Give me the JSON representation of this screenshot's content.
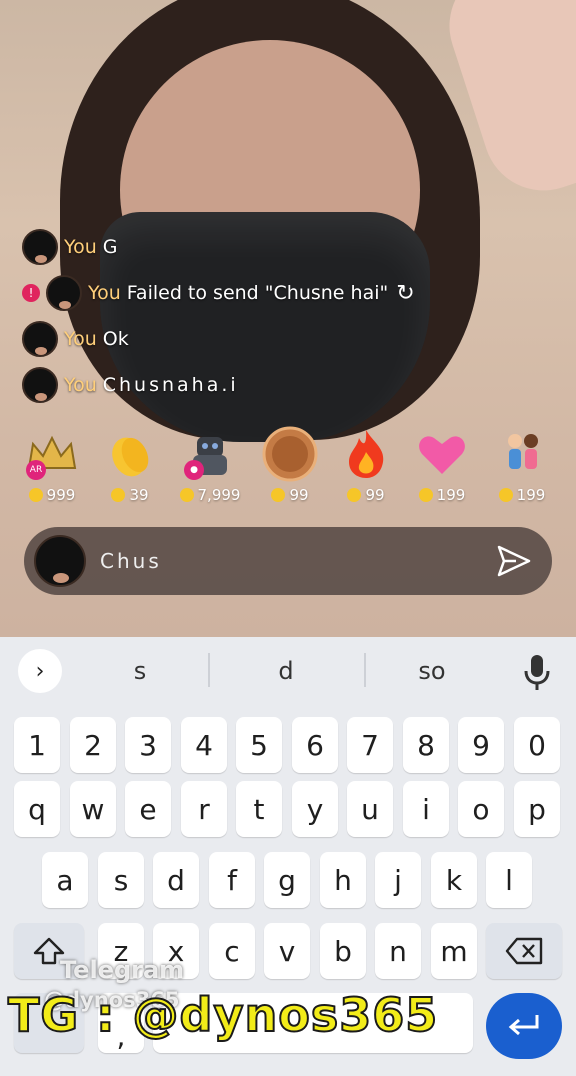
{
  "chat": {
    "messages": [
      {
        "sender": "You",
        "text": "G",
        "failed": false
      },
      {
        "sender": "You",
        "text": "Failed to send \"Chusne hai\"",
        "failed": true
      },
      {
        "sender": "You",
        "text": "Ok",
        "failed": false
      },
      {
        "sender": "You",
        "text": "Chusnaha.i",
        "failed": false
      }
    ],
    "error_badge": "!"
  },
  "gifts": [
    {
      "icon": "crown-icon",
      "price": "999",
      "tag": "AR"
    },
    {
      "icon": "clap-icon",
      "price": "39",
      "tag": ""
    },
    {
      "icon": "robot-icon",
      "price": "7,999",
      "tag": "●"
    },
    {
      "icon": "medal-icon",
      "price": "99",
      "tag": ""
    },
    {
      "icon": "fire-icon",
      "price": "99",
      "tag": ""
    },
    {
      "icon": "hearts-icon",
      "price": "199",
      "tag": ""
    },
    {
      "icon": "couple-icon",
      "price": "199",
      "tag": ""
    }
  ],
  "composer": {
    "value": "Chus"
  },
  "keyboard": {
    "suggestions": [
      "s",
      "d",
      "so"
    ],
    "row_numbers": [
      "1",
      "2",
      "3",
      "4",
      "5",
      "6",
      "7",
      "8",
      "9",
      "0"
    ],
    "row1": [
      "q",
      "w",
      "e",
      "r",
      "t",
      "y",
      "u",
      "i",
      "o",
      "p"
    ],
    "row2": [
      "a",
      "s",
      "d",
      "f",
      "g",
      "h",
      "j",
      "k",
      "l"
    ],
    "row3": [
      "z",
      "x",
      "c",
      "v",
      "b",
      "n",
      "m"
    ],
    "comma": ","
  },
  "watermark": {
    "line1": "Telegram",
    "line2": "@dynos365",
    "big": "TG : @dynos365"
  },
  "colors": {
    "accent": "#1a5fcf",
    "you": "#ffcf7a",
    "error": "#e0245e"
  }
}
